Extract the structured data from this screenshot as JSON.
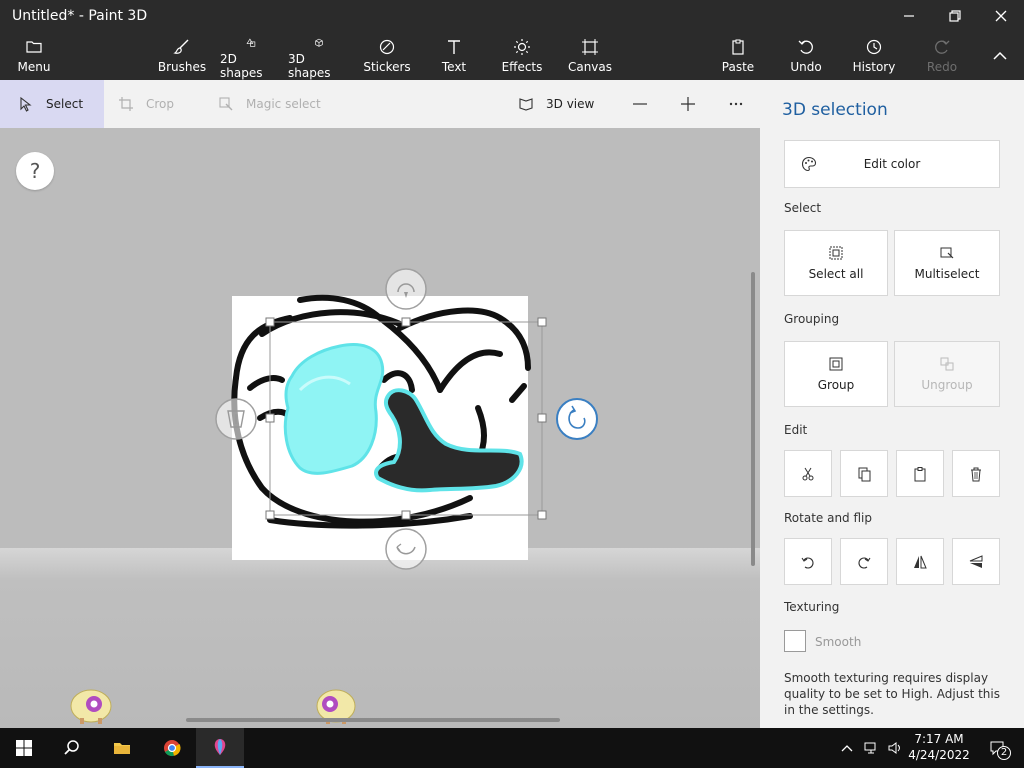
{
  "window": {
    "title": "Untitled* - Paint 3D"
  },
  "ribbon": {
    "menu": "Menu",
    "brushes": "Brushes",
    "shapes2d": "2D shapes",
    "shapes3d": "3D shapes",
    "stickers": "Stickers",
    "text": "Text",
    "effects": "Effects",
    "canvas": "Canvas",
    "paste": "Paste",
    "undo": "Undo",
    "history": "History",
    "redo": "Redo"
  },
  "toolbar": {
    "select": "Select",
    "crop": "Crop",
    "magic_select": "Magic select",
    "view3d": "3D view"
  },
  "workspace": {
    "help": "?"
  },
  "panel": {
    "heading": "3D selection",
    "edit_color": "Edit color",
    "select_label": "Select",
    "select_all": "Select all",
    "multiselect": "Multiselect",
    "grouping_label": "Grouping",
    "group": "Group",
    "ungroup": "Ungroup",
    "edit_label": "Edit",
    "rotate_label": "Rotate and flip",
    "texturing_label": "Texturing",
    "smooth": "Smooth",
    "note": "Smooth texturing requires display quality to be set to High. Adjust this in the settings."
  },
  "taskbar": {
    "time": "7:17 AM",
    "date": "4/24/2022",
    "notifications": "2"
  },
  "colors": {
    "accent": "#1f5fa0",
    "selection_cyan": "#7ff0f0",
    "dark_bg": "#2b2b2b"
  }
}
